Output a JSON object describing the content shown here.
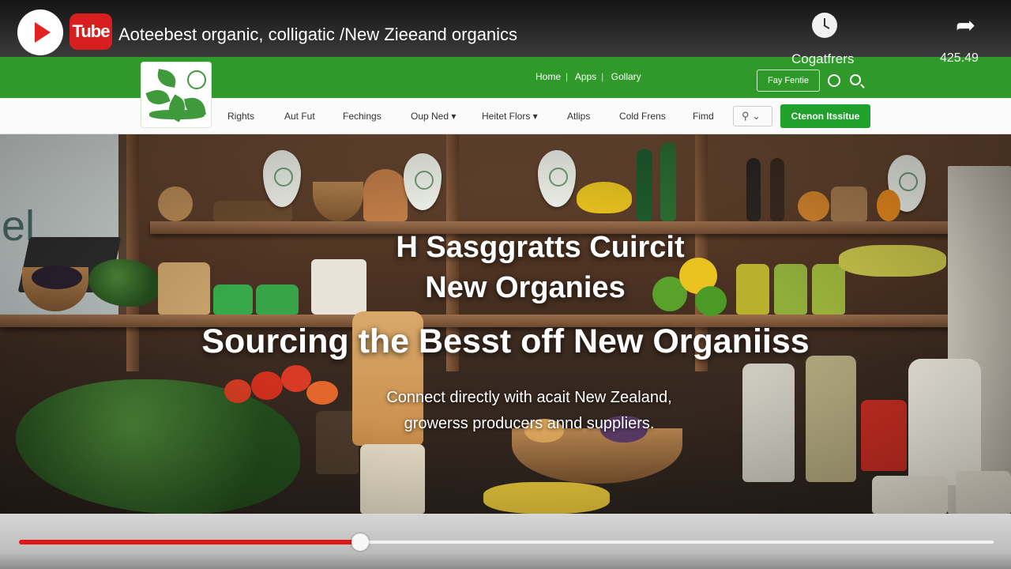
{
  "player": {
    "title": "Aoteebest organic, colligatic /New Zieeand organics",
    "logo_text": "Tube",
    "overlay_label": "Cogatfrers",
    "overlay_count": "425.49",
    "progress": 0.35,
    "icons": [
      "play-icon",
      "youtube-logo-icon",
      "clock-icon",
      "share-icon"
    ],
    "accent_color": "#e01818"
  },
  "site": {
    "topbar_color": "#2f9a2a",
    "top_links": [
      "Home",
      "Apps",
      "Gollary"
    ],
    "search_feature_label": "Fay Fentie",
    "nav_items": [
      "Rights",
      "Aut Fut",
      "Fechings",
      "Oup Ned ▾",
      "Heitet Flors ▾",
      "Atlips",
      "Cold Frens",
      "Fimd"
    ],
    "cta_label": "Ctenon Itssitue"
  },
  "hero": {
    "line1": "H Sasggratts Cuircit",
    "line2": "New Organies",
    "headline": "Sourcing the Besst off New Organiiss",
    "sub1": "Connect directly with acait New Zealand,",
    "sub2": "growerss producers annd suppliers."
  },
  "scene": {
    "window_text": "el"
  }
}
